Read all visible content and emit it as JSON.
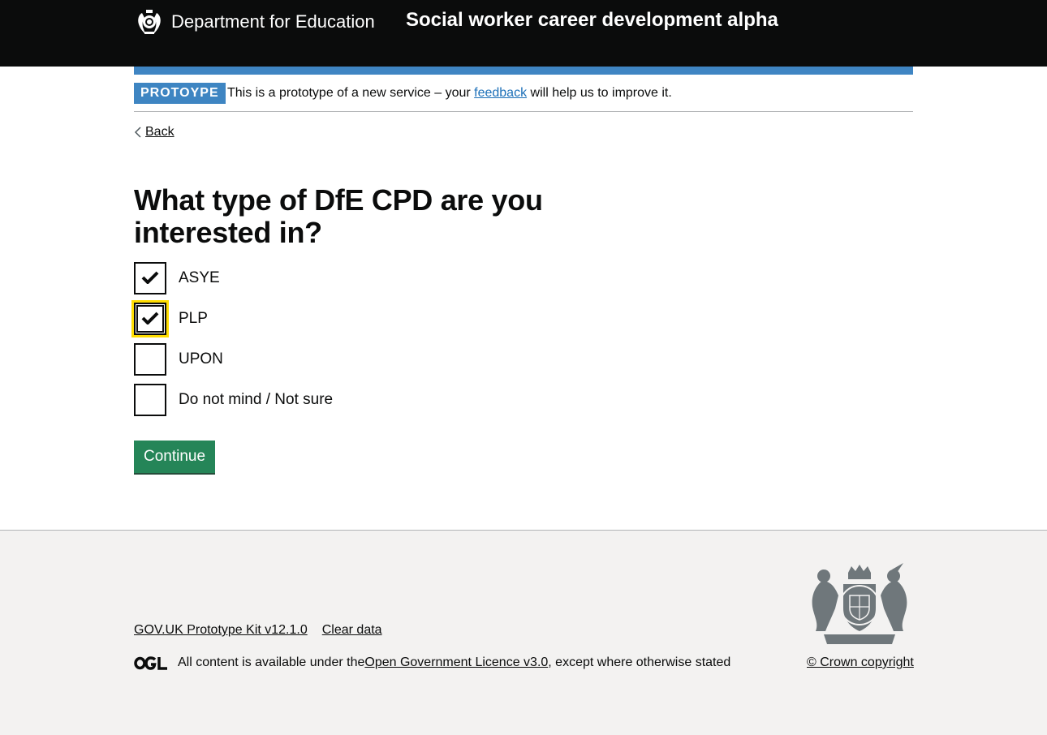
{
  "header": {
    "logo_text": "Department for Education",
    "service_name": "Social worker career development alpha",
    "logo_icon": "crest-icon"
  },
  "phase_banner": {
    "tag": "PROTOYPE",
    "text_before": "This is a prototype of a new service – your ",
    "link": "feedback",
    "text_after": " will help us to improve it."
  },
  "back_link": {
    "label": "Back",
    "icon": "chevron-left-icon"
  },
  "form": {
    "title": "What type of DfE CPD are you interested in?",
    "options": [
      {
        "label": "ASYE",
        "checked": true,
        "focused": false
      },
      {
        "label": "PLP",
        "checked": true,
        "focused": true
      },
      {
        "label": "UPON",
        "checked": false,
        "focused": false
      },
      {
        "label": "Do not mind / Not sure",
        "checked": false,
        "focused": false
      }
    ],
    "continue_label": "Continue"
  },
  "footer": {
    "links": [
      "GOV.UK Prototype Kit v12.1.0",
      "Clear data"
    ],
    "licence_before": "All content is available under the ",
    "licence_link": "Open Government Licence v3.0",
    "licence_after": ", except where otherwise stated",
    "copyright": "© Crown copyright",
    "ogl_icon": "ogl-icon",
    "arms_icon": "royal-arms-icon"
  },
  "colors": {
    "header_bg": "#0b0c0c",
    "brand_blue": "#1d70b8",
    "button_green": "#00703c",
    "focus_yellow": "#ffdd00",
    "footer_bg": "#f3f2f1"
  }
}
